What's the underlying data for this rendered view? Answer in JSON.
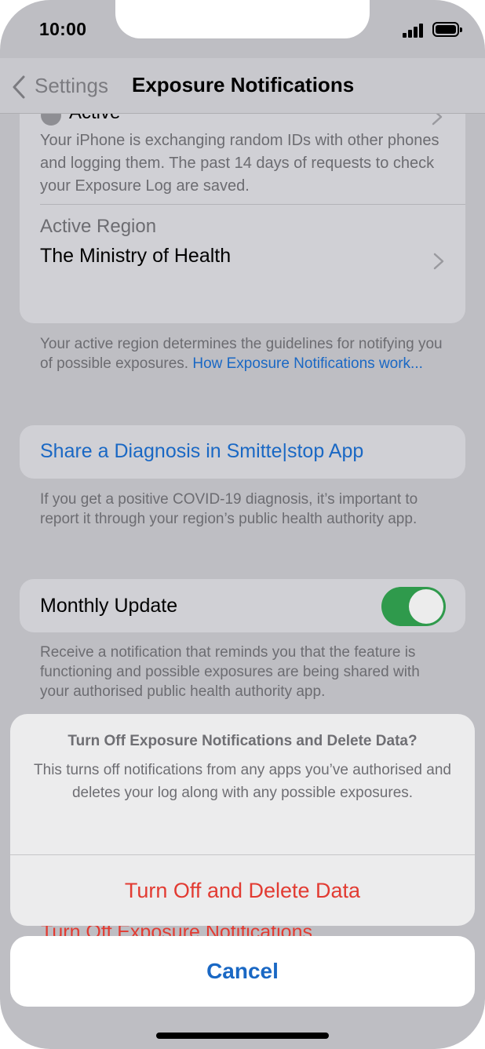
{
  "status_bar": {
    "time": "10:00"
  },
  "nav": {
    "back_label": "Settings",
    "title": "Exposure Notifications"
  },
  "status_section": {
    "label": "Active",
    "description": "Your iPhone is exchanging random IDs with other phones and logging them. The past 14 days of requests to check your Exposure Log are saved."
  },
  "region": {
    "label": "Active Region",
    "value": "The Ministry of Health",
    "footer_text": "Your active region determines the guidelines for notifying you of possible exposures. ",
    "footer_link": "How Exposure Notifications work..."
  },
  "share": {
    "label": "Share a Diagnosis in Smitte|stop App",
    "footer": "If you get a positive COVID-19 diagnosis, it’s important to report it through your region’s public health authority app."
  },
  "monthly_update": {
    "label": "Monthly Update",
    "enabled": true,
    "footer": "Receive a notification that reminds you that the feature is functioning and possible exposures are being shared with your authorised public health authority app."
  },
  "action_sheet": {
    "title": "Turn Off Exposure Notifications and Delete Data?",
    "message": "This turns off notifications from any apps you’ve authorised and deletes your log along with any possible exposures.",
    "destructive_button": "Turn Off and Delete Data",
    "obscured_item": "Turn Off Exposure Notifications",
    "cancel_button": "Cancel"
  },
  "colors": {
    "link_blue": "#1a68c4",
    "destructive_red": "#e23b32",
    "toggle_green": "#2f9a4c"
  }
}
